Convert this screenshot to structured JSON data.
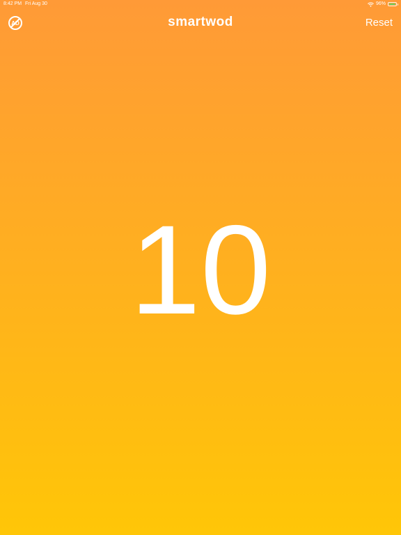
{
  "status_bar": {
    "time": "8:42 PM",
    "date": "Fri Aug 30",
    "battery_percent": "96%",
    "battery_level": 0.96,
    "battery_color": "#63d46b",
    "wifi_icon": "wifi-icon",
    "battery_icon": "battery-icon"
  },
  "nav": {
    "left_icon": "no-ads-icon",
    "title": "smartwod",
    "reset_label": "Reset"
  },
  "counter": {
    "value": "10"
  },
  "colors": {
    "gradient_top": "#ff9a37",
    "gradient_bottom": "#ffc607",
    "text": "#ffffff"
  }
}
